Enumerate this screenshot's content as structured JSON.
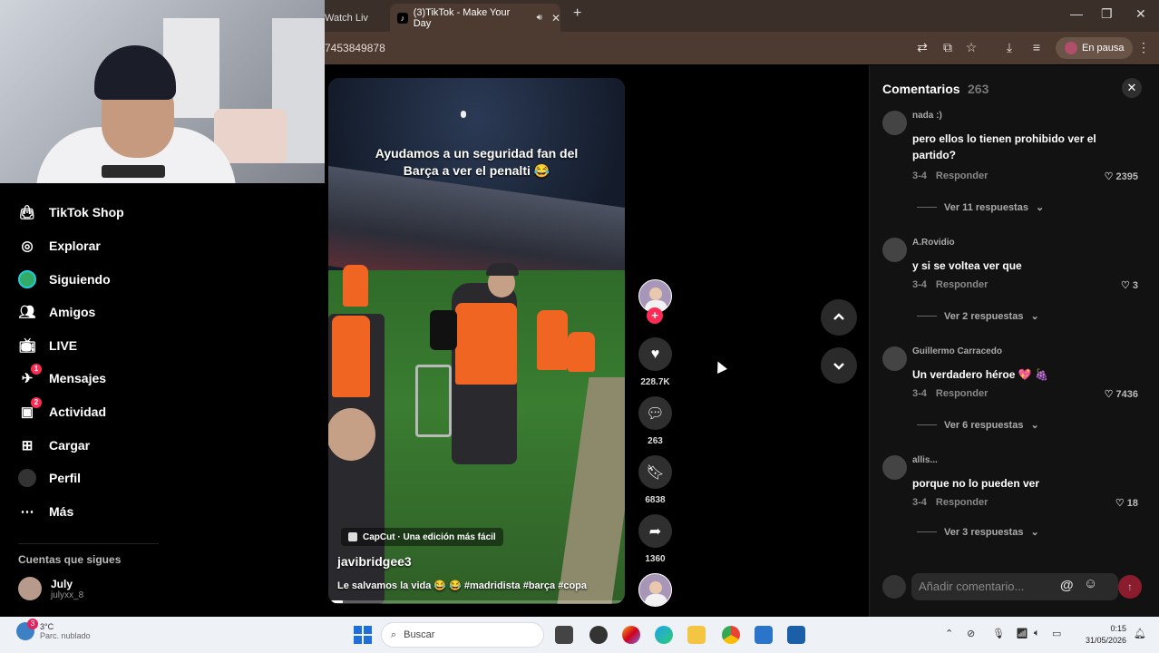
{
  "browser": {
    "partial_tab_label": "Watch Liv",
    "active_tab_label": "(3)TikTok - Make Your Day",
    "address": "7453849878",
    "profile_chip": "En pausa"
  },
  "sidebar": {
    "items": [
      {
        "label": "TikTok Shop",
        "icon": "shop-bag-icon",
        "badge": ""
      },
      {
        "label": "Explorar",
        "icon": "compass-icon",
        "badge": ""
      },
      {
        "label": "Siguiendo",
        "icon": "following-avatar-icon",
        "badge": ""
      },
      {
        "label": "Amigos",
        "icon": "friends-icon",
        "badge": ""
      },
      {
        "label": "LIVE",
        "icon": "live-tv-icon",
        "badge": ""
      },
      {
        "label": "Mensajes",
        "icon": "messages-icon",
        "badge": "1"
      },
      {
        "label": "Actividad",
        "icon": "activity-icon",
        "badge": "2"
      },
      {
        "label": "Cargar",
        "icon": "upload-icon",
        "badge": ""
      },
      {
        "label": "Perfil",
        "icon": "profile-icon",
        "badge": ""
      },
      {
        "label": "Más",
        "icon": "more-icon",
        "badge": ""
      }
    ],
    "following_title": "Cuentas que sigues",
    "following": [
      {
        "name": "July",
        "handle": "julyxx_8"
      }
    ]
  },
  "video": {
    "caption": "Ayudamos a un seguridad fan del Barça a ver el penalti 😂",
    "capcut_label": "CapCut · Una edición más fácil",
    "author": "javibridgee3",
    "description": "Le salvamos la vida 😂 😂 #madridista #barça #copa",
    "progress": 0.05
  },
  "actions": {
    "likes": "228.7K",
    "comments": "263",
    "saves": "6838",
    "shares": "1360"
  },
  "comments_panel": {
    "title": "Comentarios",
    "count": "263",
    "input_placeholder": "Añadir comentario...",
    "at_symbol": "@",
    "items": [
      {
        "user": "nada :)",
        "text": "pero ellos lo tienen prohibido ver el partido?",
        "date": "3-4",
        "reply": "Responder",
        "likes": "2395",
        "more": "Ver 11 respuestas"
      },
      {
        "user": "A.Rovidio",
        "text": "y si se voltea ver que",
        "date": "3-4",
        "reply": "Responder",
        "likes": "3",
        "more": "Ver 2 respuestas"
      },
      {
        "user": "Guillermo Carracedo",
        "text": "Un verdadero héroe 💖 🍇",
        "date": "3-4",
        "reply": "Responder",
        "likes": "7436",
        "more": "Ver 6 respuestas"
      },
      {
        "user": "allis...",
        "text": "porque no lo pueden ver",
        "date": "3-4",
        "reply": "Responder",
        "likes": "18",
        "more": "Ver 3 respuestas"
      }
    ]
  },
  "taskbar": {
    "weather_temp": "3°C",
    "weather_desc": "Parc. nublado",
    "weather_badge": "3",
    "search_placeholder": "Buscar",
    "time": "0:15",
    "date": "31/05/2026"
  },
  "colors": {
    "accent": "#fe2c55",
    "chrome": "#4d3b32",
    "tabbar": "#3b2f29"
  }
}
